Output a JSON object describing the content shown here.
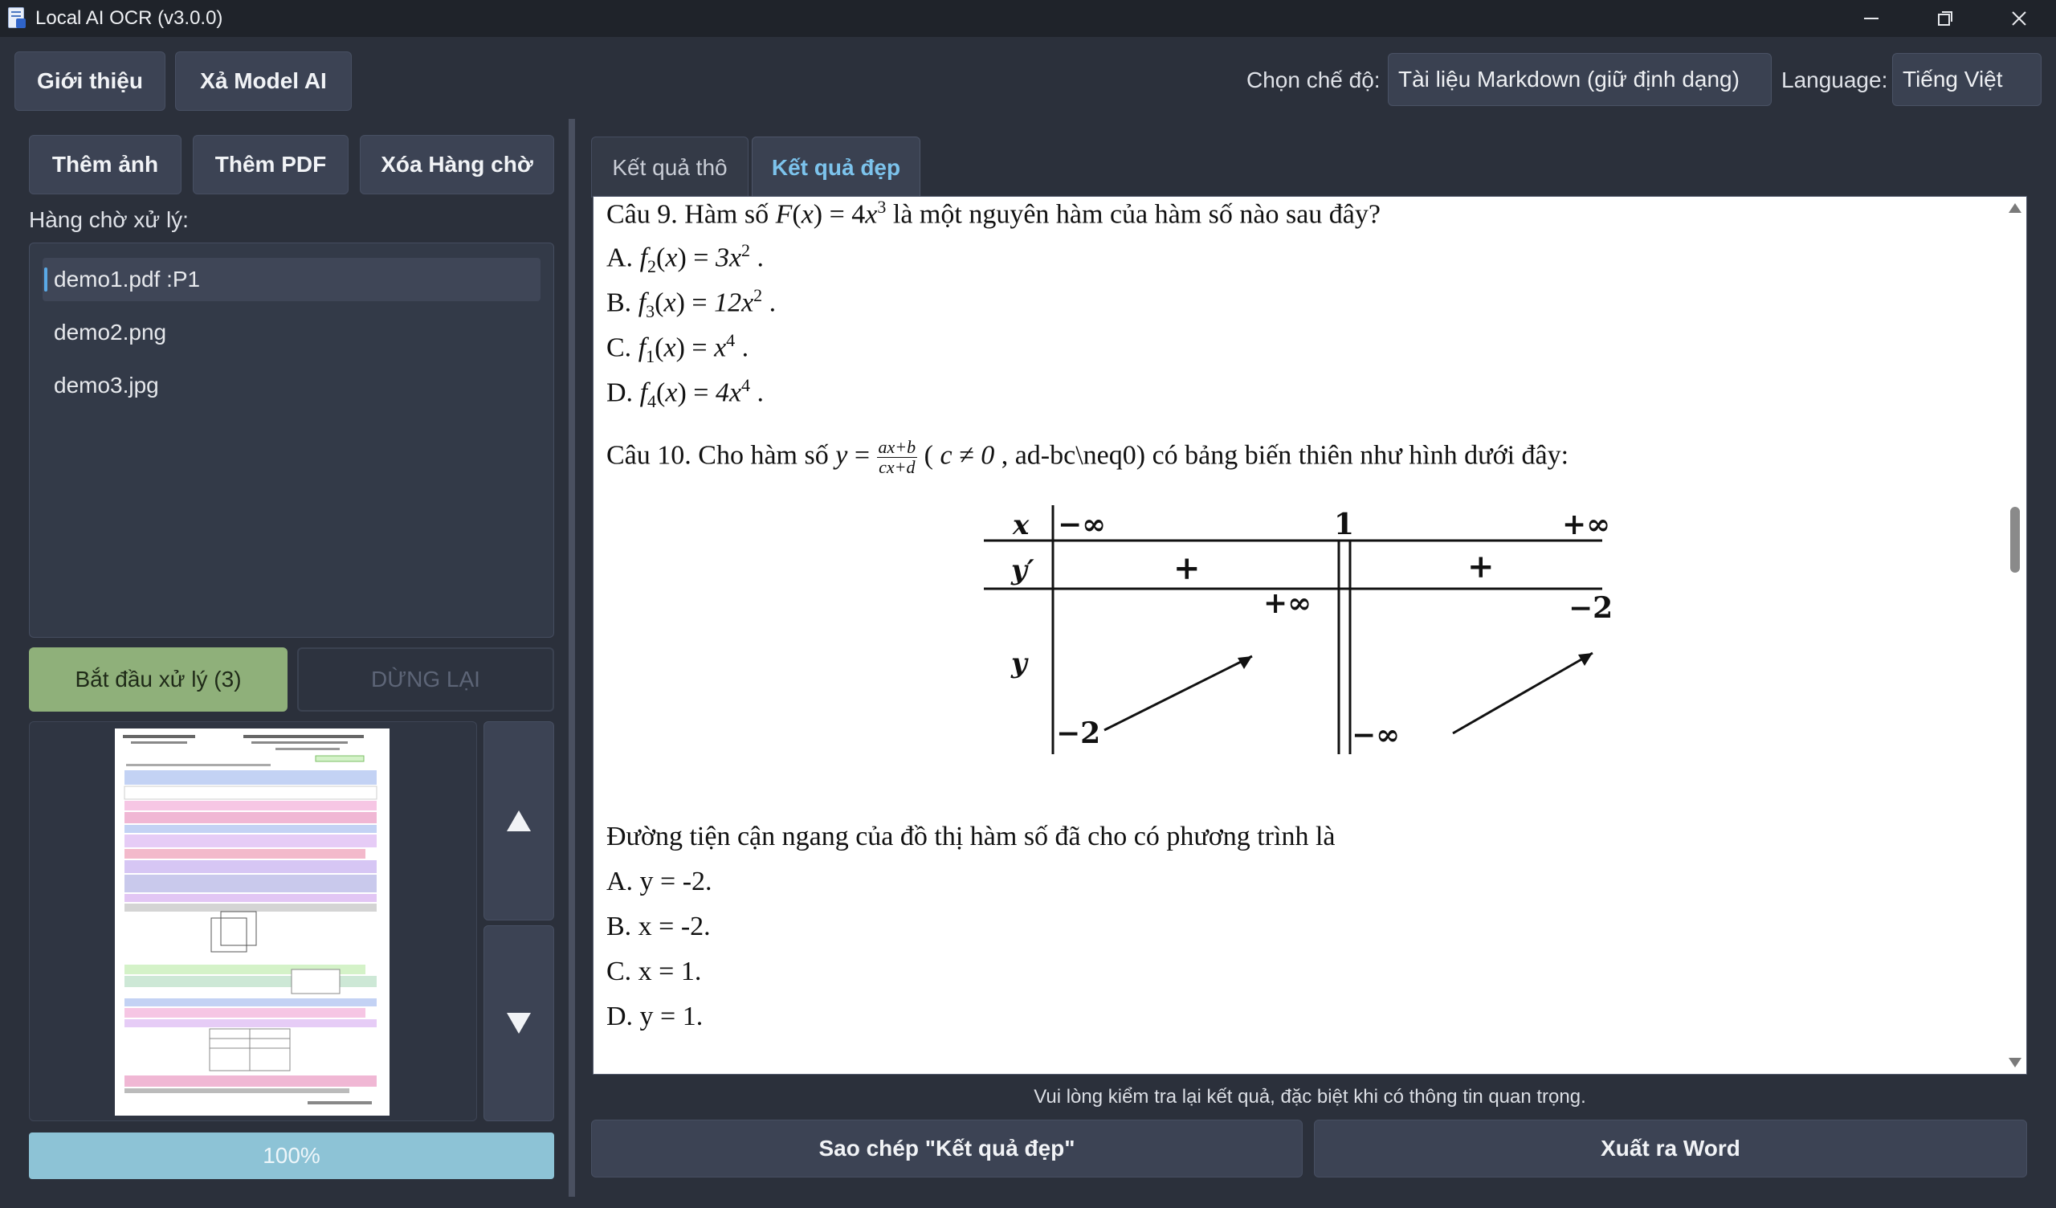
{
  "window": {
    "title": "Local AI OCR (v3.0.0)"
  },
  "toolbar": {
    "intro_label": "Giới thiệu",
    "unload_label": "Xả Model AI",
    "mode_label": "Chọn chế độ:",
    "mode_value": "Tài liệu Markdown (giữ định dạng)",
    "language_label": "Language:",
    "language_value": "Tiếng Việt"
  },
  "left": {
    "add_image_label": "Thêm ảnh",
    "add_pdf_label": "Thêm PDF",
    "clear_queue_label": "Xóa Hàng chờ",
    "queue_label": "Hàng chờ xử lý:",
    "queue_items": [
      "demo1.pdf :P1",
      "demo2.png",
      "demo3.jpg"
    ],
    "start_label": "Bắt đầu xử lý (3)",
    "stop_label": "DỪNG LẠI",
    "progress_text": "100%",
    "progress_value": 100
  },
  "tabs": {
    "raw_label": "Kết quả thô",
    "pretty_label": "Kết quả đẹp"
  },
  "content": {
    "q9": {
      "lead": "Câu 9. Hàm số ",
      "tail": " là một nguyên hàm của hàm số nào sau đây?"
    },
    "q9_options": [
      {
        "letter": "A. ",
        "sub": "2",
        "rhs": "3x",
        "exp": "2"
      },
      {
        "letter": "B. ",
        "sub": "3",
        "rhs": "12x",
        "exp": "2"
      },
      {
        "letter": "C. ",
        "sub": "1",
        "rhs": "x",
        "exp": "4"
      },
      {
        "letter": "D. ",
        "sub": "4",
        "rhs": "4x",
        "exp": "4"
      }
    ],
    "q10": {
      "lead": "Câu 10. Cho hàm số ",
      "frac_num": "ax+b",
      "frac_den": "cx+d",
      "mid": " ( ",
      "cond": "c ≠ 0",
      "tail": " , ad-bc\\neq0) có bảng biến thiên như hình dưới đây:"
    },
    "table": {
      "x": "x",
      "yp": "y′",
      "y": "y",
      "neg_inf": "−∞",
      "one": "1",
      "pos_inf": "+∞",
      "plus": "+",
      "neg_two": "−2"
    },
    "asymptote_question": "Đường tiện cận ngang của đồ thị hàm số đã cho có phương trình là",
    "asymptote_options": [
      "A. y = -2.",
      "B. x = -2.",
      "C. x = 1.",
      "D. y = 1."
    ]
  },
  "footer": {
    "note": "Vui lòng kiểm tra lại kết quả, đặc biệt khi có thông tin quan trọng.",
    "copy_label": "Sao chép \"Kết quả đẹp\"",
    "export_label": "Xuất ra Word"
  }
}
